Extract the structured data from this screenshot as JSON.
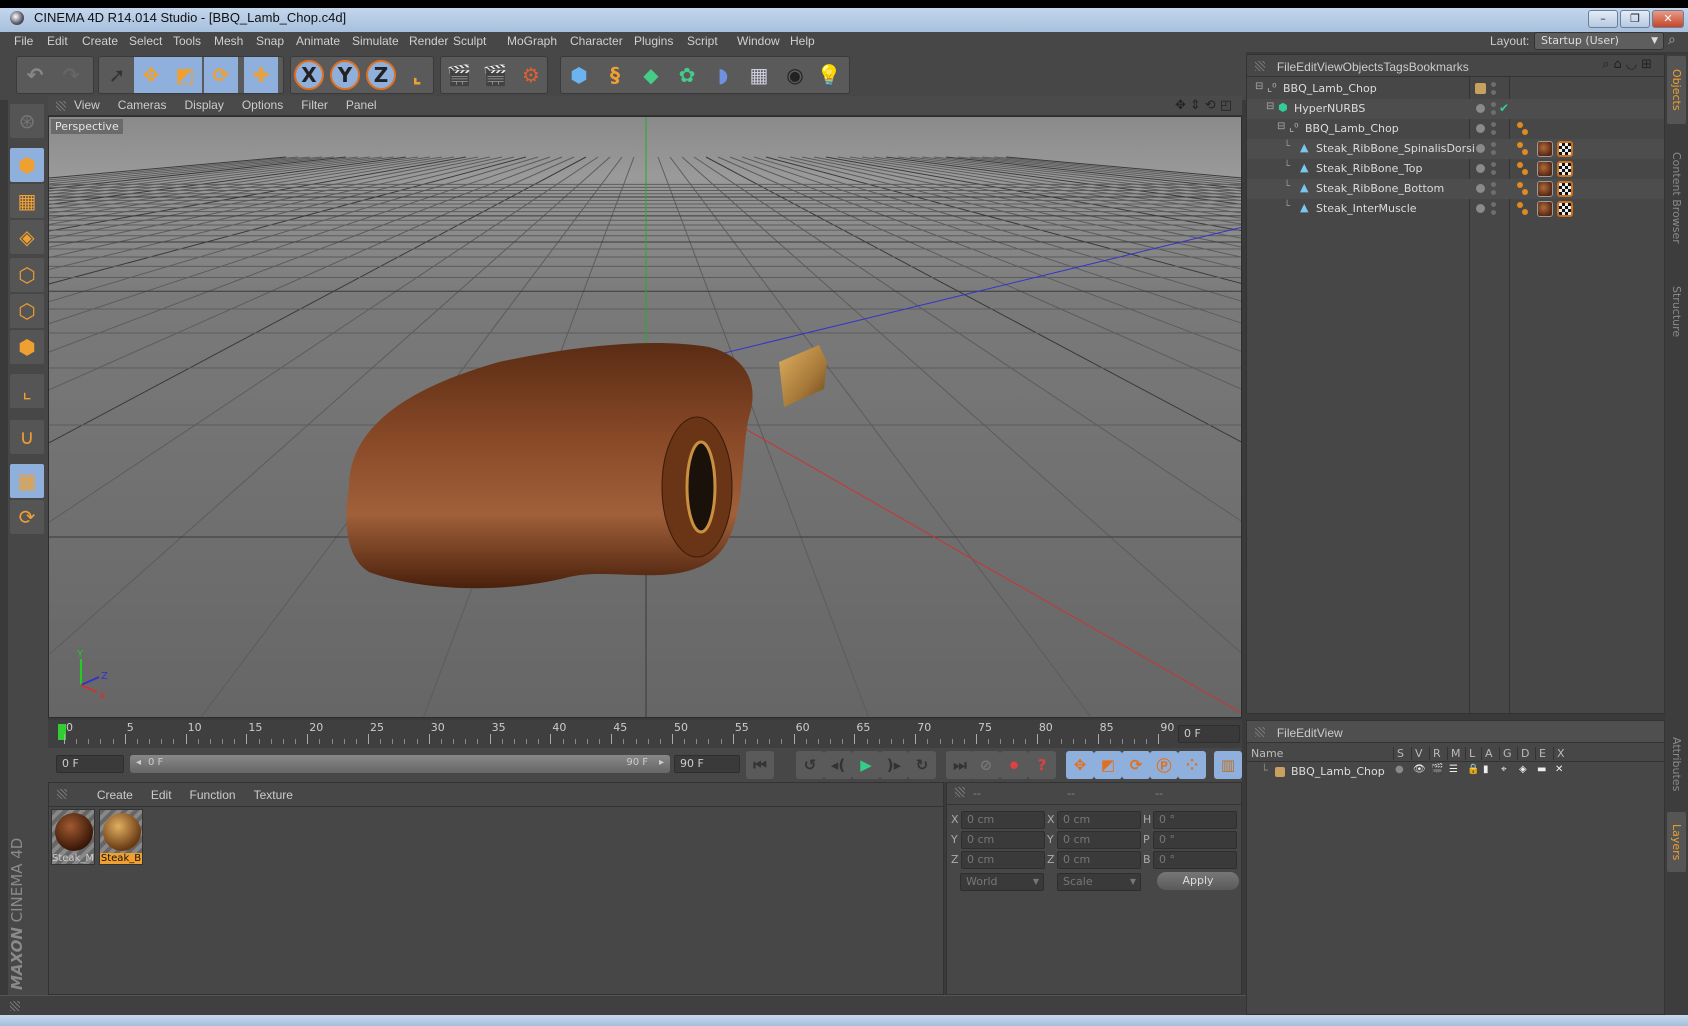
{
  "window": {
    "title": "CINEMA 4D R14.014 Studio - [BBQ_Lamb_Chop.c4d]",
    "buttons": {
      "minimize": "–",
      "restore": "❐",
      "close": "✕"
    }
  },
  "menubar": {
    "items": [
      "File",
      "Edit",
      "Create",
      "Select",
      "Tools",
      "Mesh",
      "Snap",
      "Animate",
      "Simulate",
      "Render",
      "Sculpt",
      "MoGraph",
      "Character",
      "Plugins",
      "Script",
      "Window",
      "Help"
    ],
    "layout_label": "Layout:",
    "layout_value": "Startup (User)"
  },
  "toolbar": {
    "buttons": [
      {
        "name": "undo",
        "glyph": "↶"
      },
      {
        "name": "redo",
        "glyph": "↷"
      },
      {
        "name": "live-selection",
        "glyph": "➚"
      },
      {
        "name": "move",
        "glyph": "✥"
      },
      {
        "name": "scale",
        "glyph": "◩"
      },
      {
        "name": "rotate",
        "glyph": "⟳"
      },
      {
        "name": "recent-tool",
        "glyph": "✚"
      },
      {
        "name": "x-axis",
        "glyph": "X"
      },
      {
        "name": "y-axis",
        "glyph": "Y"
      },
      {
        "name": "z-axis",
        "glyph": "Z"
      },
      {
        "name": "coordinate-system",
        "glyph": "⌞"
      },
      {
        "name": "render-view",
        "glyph": "🎬"
      },
      {
        "name": "render-picture-viewer",
        "glyph": "🎬"
      },
      {
        "name": "render-settings",
        "glyph": "⚙"
      },
      {
        "name": "cube",
        "glyph": "⬢"
      },
      {
        "name": "spline",
        "glyph": "§"
      },
      {
        "name": "nurbs",
        "glyph": "◆"
      },
      {
        "name": "array",
        "glyph": "✿"
      },
      {
        "name": "deformer",
        "glyph": "◗"
      },
      {
        "name": "floor",
        "glyph": "▦"
      },
      {
        "name": "camera",
        "glyph": "◉"
      },
      {
        "name": "light",
        "glyph": "💡"
      }
    ]
  },
  "left_toolbar": {
    "buttons": [
      "make-editable",
      "model-mode",
      "texture-mode",
      "workplane-mode",
      "points-mode",
      "edges-mode",
      "polygons-mode",
      "axis-mode",
      "snap",
      "locked-workplane",
      "workplane-sync"
    ]
  },
  "viewport": {
    "menu": [
      "View",
      "Cameras",
      "Display",
      "Options",
      "Filter",
      "Panel"
    ],
    "label": "Perspective",
    "nav_icons": [
      "move-view",
      "zoom-view",
      "rotate-view",
      "maximize-view"
    ],
    "axis_labels": {
      "y": "Y",
      "z": "Z",
      "x": "X"
    }
  },
  "timeline": {
    "ticks": [
      "0",
      "5",
      "10",
      "15",
      "20",
      "25",
      "30",
      "35",
      "40",
      "45",
      "50",
      "55",
      "60",
      "65",
      "70",
      "75",
      "80",
      "85",
      "90"
    ],
    "current_frame_display": "0 F",
    "start_field": "0 F",
    "range_start": "0 F",
    "range_end": "90 F",
    "end_field": "90 F",
    "playback_buttons": [
      "go-to-start",
      "previous-key",
      "previous-frame",
      "play",
      "next-frame",
      "next-key",
      "go-to-end"
    ],
    "record_buttons": [
      "record-active",
      "autokey",
      "keyframe-selection"
    ],
    "key_buttons": [
      "position-key",
      "scale-key",
      "rotation-key",
      "parameter-key",
      "pla-key"
    ],
    "timeline_button": "timeline"
  },
  "materials": {
    "menu": [
      "Create",
      "Edit",
      "Function",
      "Texture"
    ],
    "items": [
      {
        "label": "Steak_M",
        "selected": false
      },
      {
        "label": "Steak_B",
        "selected": true
      }
    ]
  },
  "coordinates": {
    "headers": [
      "--",
      "--",
      "--"
    ],
    "rows": [
      {
        "l1": "X",
        "v1": "0 cm",
        "l2": "X",
        "v2": "0 cm",
        "l3": "H",
        "v3": "0 °"
      },
      {
        "l1": "Y",
        "v1": "0 cm",
        "l2": "Y",
        "v2": "0 cm",
        "l3": "P",
        "v3": "0 °"
      },
      {
        "l1": "Z",
        "v1": "0 cm",
        "l2": "Z",
        "v2": "0 cm",
        "l3": "B",
        "v3": "0 °"
      }
    ],
    "mode_select": "World",
    "type_select": "Scale",
    "apply_label": "Apply"
  },
  "objects": {
    "menu": [
      "File",
      "Edit",
      "View",
      "Objects",
      "Tags",
      "Bookmarks"
    ],
    "tree": [
      {
        "name": "BBQ_Lamb_Chop",
        "type": "null",
        "indent": 0,
        "tags": []
      },
      {
        "name": "HyperNURBS",
        "type": "hypernurbs",
        "indent": 1,
        "tags": [],
        "enabled_check": "✔"
      },
      {
        "name": "BBQ_Lamb_Chop",
        "type": "null",
        "indent": 2,
        "tags": [
          "phong"
        ]
      },
      {
        "name": "Steak_RibBone_SpinalisDorsi",
        "type": "polygon",
        "indent": 3,
        "tags": [
          "phong",
          "material",
          "texture"
        ]
      },
      {
        "name": "Steak_RibBone_Top",
        "type": "polygon",
        "indent": 3,
        "tags": [
          "phong",
          "material",
          "texture"
        ]
      },
      {
        "name": "Steak_RibBone_Bottom",
        "type": "polygon",
        "indent": 3,
        "tags": [
          "phong",
          "material",
          "texture"
        ]
      },
      {
        "name": "Steak_InterMuscle",
        "type": "polygon",
        "indent": 3,
        "tags": [
          "phong",
          "material",
          "texture"
        ]
      }
    ]
  },
  "layers": {
    "menu": [
      "File",
      "Edit",
      "View"
    ],
    "columns": [
      "Name",
      "S",
      "V",
      "R",
      "M",
      "L",
      "A",
      "G",
      "D",
      "E",
      "X"
    ],
    "rows": [
      {
        "name": "BBQ_Lamb_Chop",
        "color": "#c8a060"
      }
    ]
  },
  "side_tabs": {
    "top": [
      {
        "label": "Objects",
        "active": true
      },
      {
        "label": "Content Browser",
        "active": false
      },
      {
        "label": "Structure",
        "active": false
      }
    ],
    "bottom": [
      {
        "label": "Attributes",
        "active": false
      },
      {
        "label": "Layers",
        "active": true
      }
    ]
  },
  "branding": {
    "maxon": "MAXON",
    "product": "CINEMA 4D"
  },
  "colors": {
    "accent": "#f0a030",
    "selection": "#8fb0dc",
    "panel": "#474747",
    "viewport_bg": "#808080"
  }
}
